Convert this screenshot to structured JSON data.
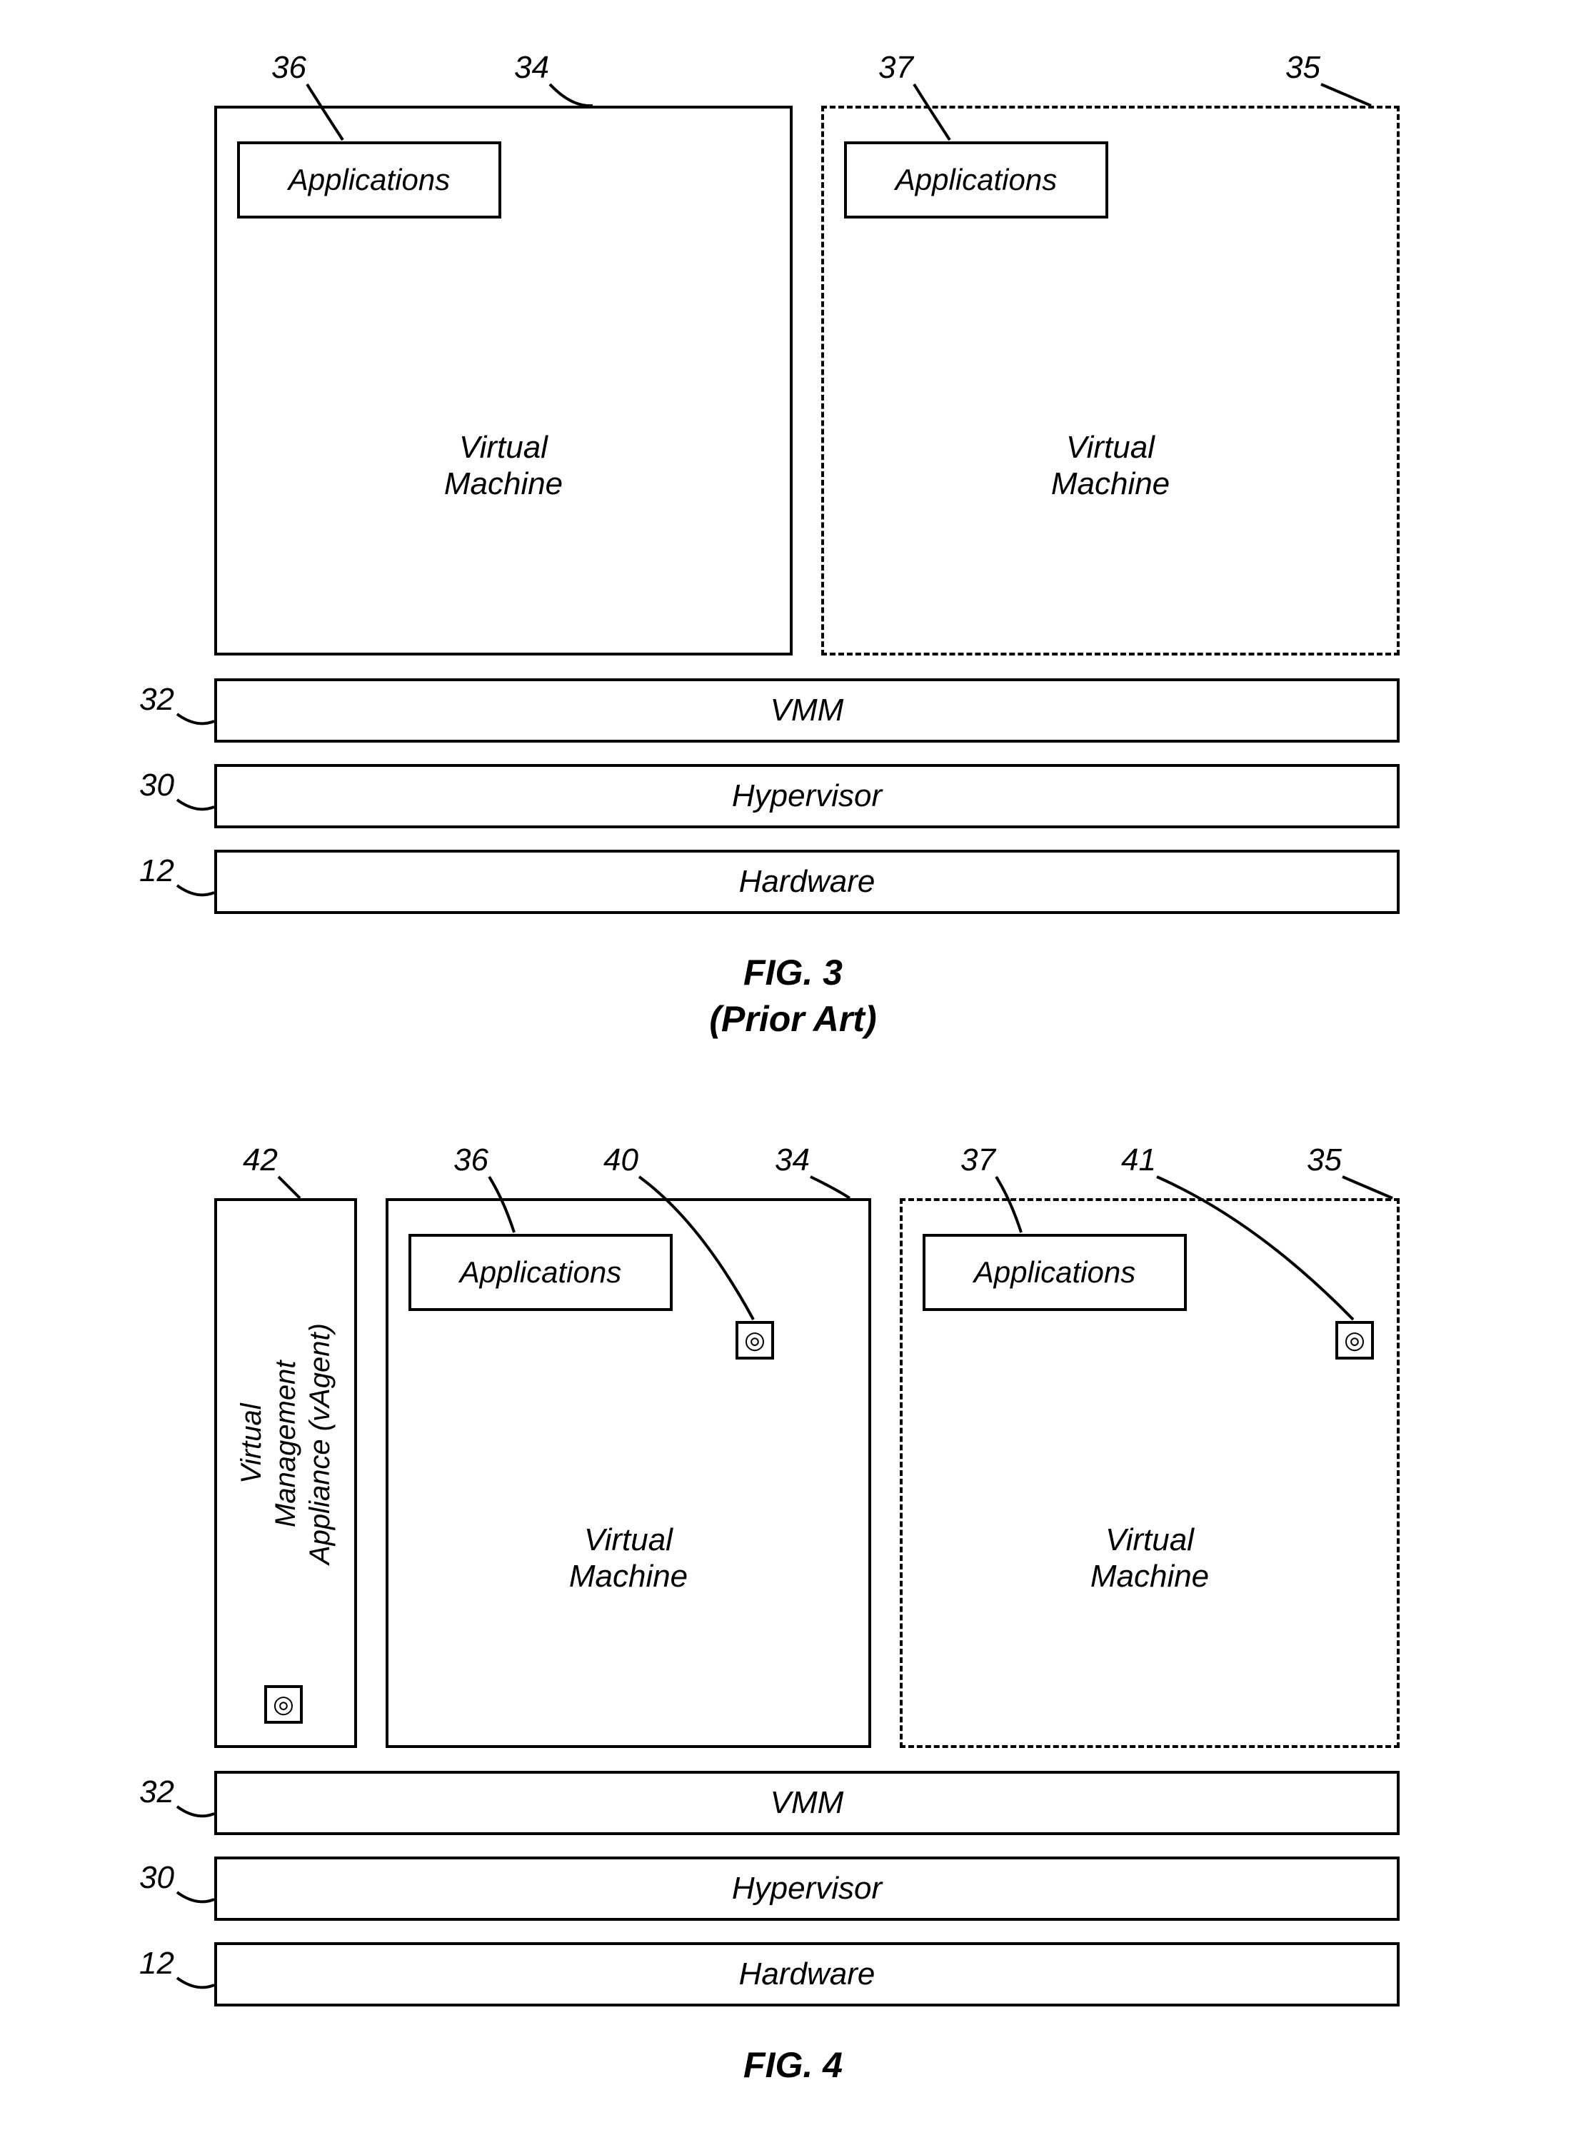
{
  "fig3": {
    "caption_line1": "FIG. 3",
    "caption_line2": "(Prior Art)",
    "refs": {
      "r36": "36",
      "r34": "34",
      "r37": "37",
      "r35": "35",
      "r32": "32",
      "r30": "30",
      "r12": "12"
    },
    "labels": {
      "applications": "Applications",
      "virtual_machine": "Virtual\nMachine",
      "vmm": "VMM",
      "hypervisor": "Hypervisor",
      "hardware": "Hardware"
    }
  },
  "fig4": {
    "caption": "FIG. 4",
    "refs": {
      "r42": "42",
      "r36": "36",
      "r40": "40",
      "r34": "34",
      "r37": "37",
      "r41": "41",
      "r35": "35",
      "r32": "32",
      "r30": "30",
      "r12": "12"
    },
    "labels": {
      "vagent": "Virtual\nManagement\nAppliance (vAgent)",
      "applications": "Applications",
      "virtual_machine": "Virtual\nMachine",
      "vmm": "VMM",
      "hypervisor": "Hypervisor",
      "hardware": "Hardware"
    }
  }
}
